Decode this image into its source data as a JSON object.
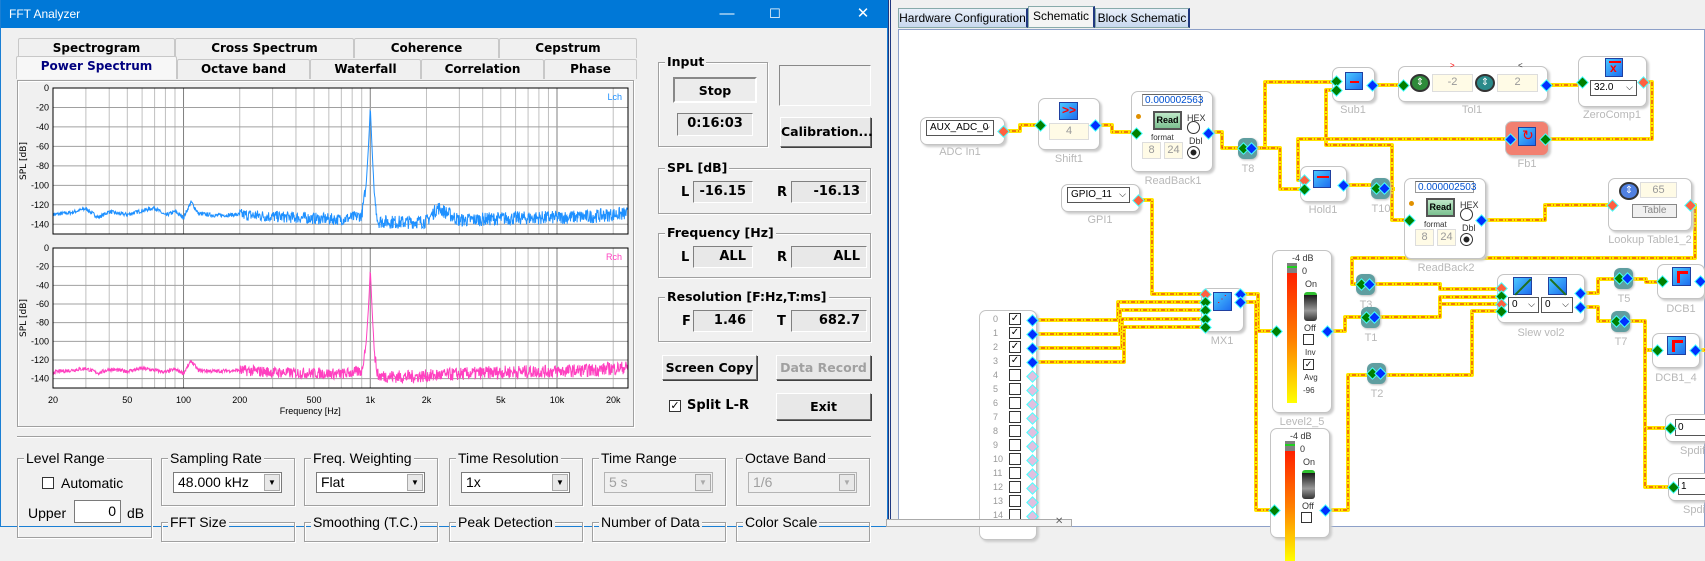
{
  "window": {
    "title": "FFT Analyzer",
    "minimize": "—",
    "maximize": "☐",
    "close": "✕"
  },
  "tabs_row1": [
    "Spectrogram",
    "Cross Spectrum",
    "Coherence",
    "Cepstrum"
  ],
  "tabs_row2": [
    "Power Spectrum",
    "Octave band",
    "Waterfall",
    "Correlation",
    "Phase"
  ],
  "active_tab": "Power Spectrum",
  "chart_data": [
    {
      "type": "line",
      "channel_label": "Lch",
      "color": "#1e90ff",
      "ylabel": "SPL [dB]",
      "xlabel": "",
      "xscale": "log",
      "xlim": [
        20,
        24000
      ],
      "ylim": [
        -150,
        0
      ],
      "grid": true,
      "yticks": [
        "0",
        "-20",
        "-40",
        "-60",
        "-80",
        "-100",
        "-120",
        "-140"
      ],
      "points": [
        [
          20,
          -130
        ],
        [
          25,
          -128
        ],
        [
          30,
          -124
        ],
        [
          35,
          -133
        ],
        [
          40,
          -127
        ],
        [
          45,
          -129
        ],
        [
          50,
          -130
        ],
        [
          60,
          -126
        ],
        [
          70,
          -123
        ],
        [
          80,
          -131
        ],
        [
          90,
          -127
        ],
        [
          100,
          -133
        ],
        [
          110,
          -117
        ],
        [
          120,
          -129
        ],
        [
          150,
          -131
        ],
        [
          200,
          -130
        ],
        [
          300,
          -132
        ],
        [
          400,
          -133
        ],
        [
          500,
          -134
        ],
        [
          700,
          -135
        ],
        [
          900,
          -131
        ],
        [
          950,
          -100
        ],
        [
          980,
          -58
        ],
        [
          1000,
          -19
        ],
        [
          1020,
          -57
        ],
        [
          1050,
          -108
        ],
        [
          1100,
          -134
        ],
        [
          1500,
          -135
        ],
        [
          2000,
          -134
        ],
        [
          2300,
          -120
        ],
        [
          3000,
          -133
        ],
        [
          5000,
          -131
        ],
        [
          10000,
          -130
        ],
        [
          15000,
          -129
        ],
        [
          20000,
          -127
        ],
        [
          24000,
          -126
        ]
      ]
    },
    {
      "type": "line",
      "channel_label": "Rch",
      "color": "#ff40c0",
      "ylabel": "SPL [dB]",
      "xlabel": "Frequency [Hz]",
      "xscale": "log",
      "xlim": [
        20,
        24000
      ],
      "ylim": [
        -150,
        0
      ],
      "grid": true,
      "yticks": [
        "0",
        "-20",
        "-40",
        "-60",
        "-80",
        "-100",
        "-120",
        "-140"
      ],
      "xticks": [
        "20",
        "50",
        "100",
        "200",
        "500",
        "1k",
        "2k",
        "5k",
        "10k",
        "20k"
      ],
      "points": [
        [
          20,
          -133
        ],
        [
          25,
          -131
        ],
        [
          30,
          -129
        ],
        [
          35,
          -134
        ],
        [
          40,
          -130
        ],
        [
          50,
          -132
        ],
        [
          60,
          -129
        ],
        [
          70,
          -131
        ],
        [
          80,
          -133
        ],
        [
          90,
          -130
        ],
        [
          100,
          -134
        ],
        [
          110,
          -121
        ],
        [
          120,
          -131
        ],
        [
          150,
          -132
        ],
        [
          200,
          -131
        ],
        [
          300,
          -133
        ],
        [
          400,
          -134
        ],
        [
          500,
          -134
        ],
        [
          700,
          -135
        ],
        [
          900,
          -132
        ],
        [
          950,
          -102
        ],
        [
          980,
          -62
        ],
        [
          1000,
          -22
        ],
        [
          1020,
          -60
        ],
        [
          1050,
          -110
        ],
        [
          1100,
          -134
        ],
        [
          1500,
          -135
        ],
        [
          2000,
          -134
        ],
        [
          3000,
          -132
        ],
        [
          5000,
          -130
        ],
        [
          10000,
          -129
        ],
        [
          15000,
          -128
        ],
        [
          20000,
          -126
        ],
        [
          24000,
          -125
        ]
      ]
    }
  ],
  "input": {
    "title": "Input",
    "stop": "Stop",
    "time": "0:16:03"
  },
  "calibration": "Calibration...",
  "spl": {
    "title": "SPL [dB]",
    "l_label": "L",
    "l": "-16.15",
    "r_label": "R",
    "r": "-16.13"
  },
  "frequency": {
    "title": "Frequency [Hz]",
    "l_label": "L",
    "l": "ALL",
    "r_label": "R",
    "r": "ALL"
  },
  "resolution": {
    "title": "Resolution [F:Hz,T:ms]",
    "f_label": "F",
    "f": "1.46",
    "t_label": "T",
    "t": "682.7"
  },
  "screen_copy": "Screen Copy",
  "data_record": "Data Record",
  "split_lr": "Split L-R",
  "split_checked": true,
  "exit": "Exit",
  "level_range": {
    "title": "Level Range",
    "automatic": "Automatic",
    "upper_label": "Upper",
    "upper": "0",
    "unit": "dB"
  },
  "groups": [
    {
      "title": "Sampling Rate",
      "value": "48.000 kHz",
      "enabled": true
    },
    {
      "title": "Freq. Weighting",
      "value": "Flat",
      "enabled": true
    },
    {
      "title": "Time Resolution",
      "value": "1x",
      "enabled": true
    },
    {
      "title": "Time Range",
      "value": "5 s",
      "enabled": false
    },
    {
      "title": "Octave Band",
      "value": "1/6",
      "enabled": false
    }
  ],
  "groups_row2": [
    "FFT Size",
    "Smoothing (T.C.)",
    "Peak Detection",
    "Number of Data",
    "Color Scale"
  ],
  "schematic": {
    "tabs": [
      "Hardware Configuration",
      "Schematic",
      "Block Schematic"
    ],
    "active": "Schematic",
    "adc": {
      "value": "AUX_ADC_0",
      "label": "ADC In1"
    },
    "shift": {
      "value": "4",
      "label": "Shift1"
    },
    "readback1": {
      "value": "0.000002563",
      "read": "Read",
      "hex": "HEX",
      "dbl": "Dbl",
      "format": "format",
      "a": "8",
      "b": "24",
      "label": "ReadBack1"
    },
    "readback2": {
      "value": "0.000002503",
      "read": "Read",
      "hex": "HEX",
      "dbl": "Dbl",
      "format": "format",
      "a": "8",
      "b": "24",
      "label": "ReadBack2"
    },
    "gpi": {
      "value": "GPIO_11",
      "label": "GPI1"
    },
    "sub": {
      "label": "Sub1"
    },
    "tol": {
      "gt": ">",
      "lt": "<",
      "low": "-2",
      "high": "2",
      "label": "Tol1"
    },
    "zerocomp": {
      "value": "32.0",
      "label": "ZeroComp1"
    },
    "fb": {
      "label": "Fb1"
    },
    "hold": {
      "label": "Hold1"
    },
    "lookup": {
      "value": "65",
      "table": "Table",
      "label": "Lookup Table1_2"
    },
    "tees": [
      "T8",
      "T10",
      "T3",
      "T1",
      "T2",
      "T5",
      "T7"
    ],
    "mx": {
      "label": "MX1"
    },
    "level1": {
      "db": "-4 dB",
      "zero": "0",
      "on": "On",
      "off": "Off",
      "inv": "Inv",
      "avg": "Avg",
      "min": "-96",
      "label": "Level2_5",
      "inv_checked": false,
      "avg_checked": true
    },
    "level2": {
      "db": "-4 dB",
      "zero": "0",
      "on": "On",
      "off": "Off"
    },
    "slew": {
      "a": "0",
      "b": "0",
      "label": "Slew vol2"
    },
    "dcb1": {
      "label": "DCB1"
    },
    "dcb2": {
      "label": "DCB1_4"
    },
    "spdif1": {
      "value": "0",
      "label": "SpdifO"
    },
    "spdif2": {
      "value": "1",
      "label": "SpdifO"
    },
    "channels": [
      "0",
      "1",
      "2",
      "3",
      "4",
      "5",
      "6",
      "7",
      "8",
      "9",
      "10",
      "11",
      "12",
      "13",
      "14"
    ],
    "channels_checked": [
      true,
      true,
      true,
      true,
      false,
      false,
      false,
      false,
      false,
      false,
      false,
      false,
      false,
      false,
      false
    ],
    "popup_close": "✕"
  }
}
